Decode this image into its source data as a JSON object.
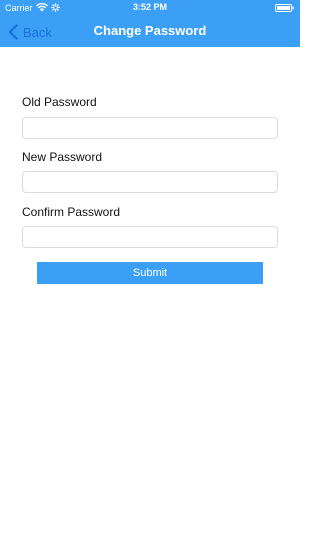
{
  "status_bar": {
    "carrier": "Carrier",
    "time": "3:52 PM",
    "icons": [
      "wifi-icon",
      "activity-icon",
      "battery-icon"
    ]
  },
  "navbar": {
    "back_label": "Back",
    "title": "Change Password",
    "back_icon": "chevron-left-icon"
  },
  "form": {
    "old_password": {
      "label": "Old Password",
      "value": ""
    },
    "new_password": {
      "label": "New Password",
      "value": ""
    },
    "confirm_password": {
      "label": "Confirm Password",
      "value": ""
    },
    "submit_label": "Submit"
  },
  "colors": {
    "header_bg": "#3a9ff5",
    "back_text": "#1e6fd9",
    "button_bg": "#3a9ff5",
    "input_border": "#dcdcdc"
  }
}
